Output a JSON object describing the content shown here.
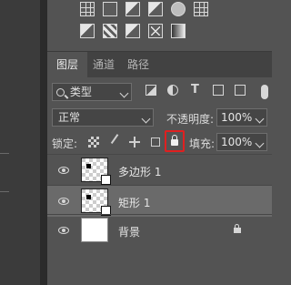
{
  "tabs": [
    {
      "label": "图层",
      "active": true
    },
    {
      "label": "通道",
      "active": false
    },
    {
      "label": "路径",
      "active": false
    }
  ],
  "filter": {
    "kind_label": "类型",
    "icons": [
      "image-filter-icon",
      "adjustment-filter-icon",
      "type-filter-icon",
      "shape-filter-icon",
      "smart-object-filter-icon"
    ]
  },
  "blend": {
    "mode": "正常",
    "opacity_label": "不透明度:",
    "opacity_value": "100%"
  },
  "lock": {
    "label": "锁定:",
    "fill_label": "填充:",
    "fill_value": "100%",
    "highlight_color": "#e02020"
  },
  "layers": [
    {
      "name": "多边形 1",
      "selected": false
    },
    {
      "name": "矩形 1",
      "selected": true
    },
    {
      "name": "背景",
      "selected": false,
      "locked": true
    }
  ]
}
